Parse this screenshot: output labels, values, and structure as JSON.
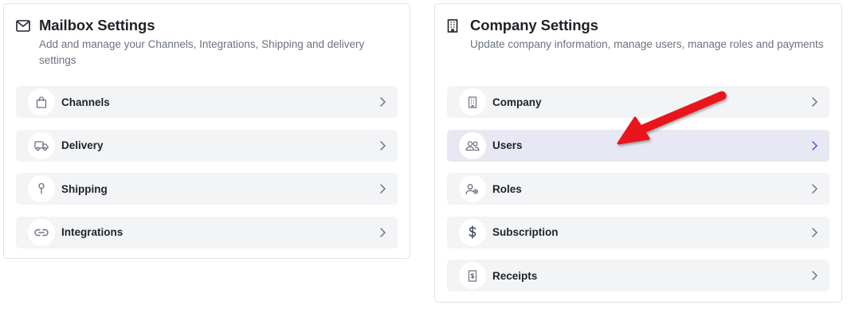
{
  "mailbox": {
    "title": "Mailbox Settings",
    "description": "Add and manage your Channels, Integrations, Shipping and delivery settings",
    "icon": "mail-icon",
    "items": [
      {
        "label": "Channels",
        "icon": "shopping-bag-icon"
      },
      {
        "label": "Delivery",
        "icon": "truck-icon"
      },
      {
        "label": "Shipping",
        "icon": "map-pin-icon"
      },
      {
        "label": "Integrations",
        "icon": "link-icon"
      }
    ]
  },
  "company": {
    "title": "Company Settings",
    "description": "Update company information, manage users, manage roles and payments",
    "icon": "building-icon",
    "items": [
      {
        "label": "Company",
        "icon": "building-icon"
      },
      {
        "label": "Users",
        "icon": "users-icon",
        "active": true
      },
      {
        "label": "Roles",
        "icon": "user-cog-icon"
      },
      {
        "label": "Subscription",
        "icon": "dollar-icon"
      },
      {
        "label": "Receipts",
        "icon": "receipt-icon"
      }
    ]
  },
  "colors": {
    "active_row": "#e7e8f3",
    "row": "#f3f4f6",
    "active_chevron": "#3b5bdb",
    "annotation_arrow": "#e8161b"
  }
}
